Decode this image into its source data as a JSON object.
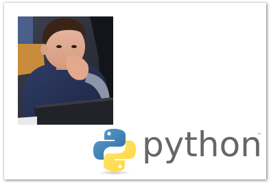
{
  "photo": {
    "description_icon": "child-at-laptop-photo"
  },
  "python_logo": {
    "icon": "python-logo-icon",
    "wordmark": "python",
    "trademark": "™",
    "colors": {
      "blue": "#3a75b0",
      "yellow": "#ffd343",
      "text": "#666666"
    }
  }
}
